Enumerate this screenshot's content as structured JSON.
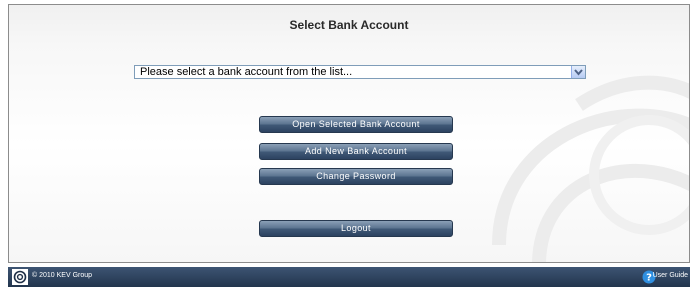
{
  "page": {
    "title": "Select Bank Account"
  },
  "account_select": {
    "selected_value": "Please select a bank account from the list..."
  },
  "buttons": {
    "open_account": "Open Selected Bank Account",
    "add_account": "Add New Bank Account",
    "change_password": "Change Password",
    "logout": "Logout"
  },
  "footer": {
    "copyright": "© 2010 KEV Group",
    "user_guide": "User Guide"
  },
  "icons": {
    "logo": "kev-logo-icon",
    "select_arrow": "chevron-down-icon",
    "help": "help-icon"
  },
  "colors": {
    "button": "#3f5876",
    "footer": "#2c4260",
    "help_icon": "#2f8fe0"
  }
}
